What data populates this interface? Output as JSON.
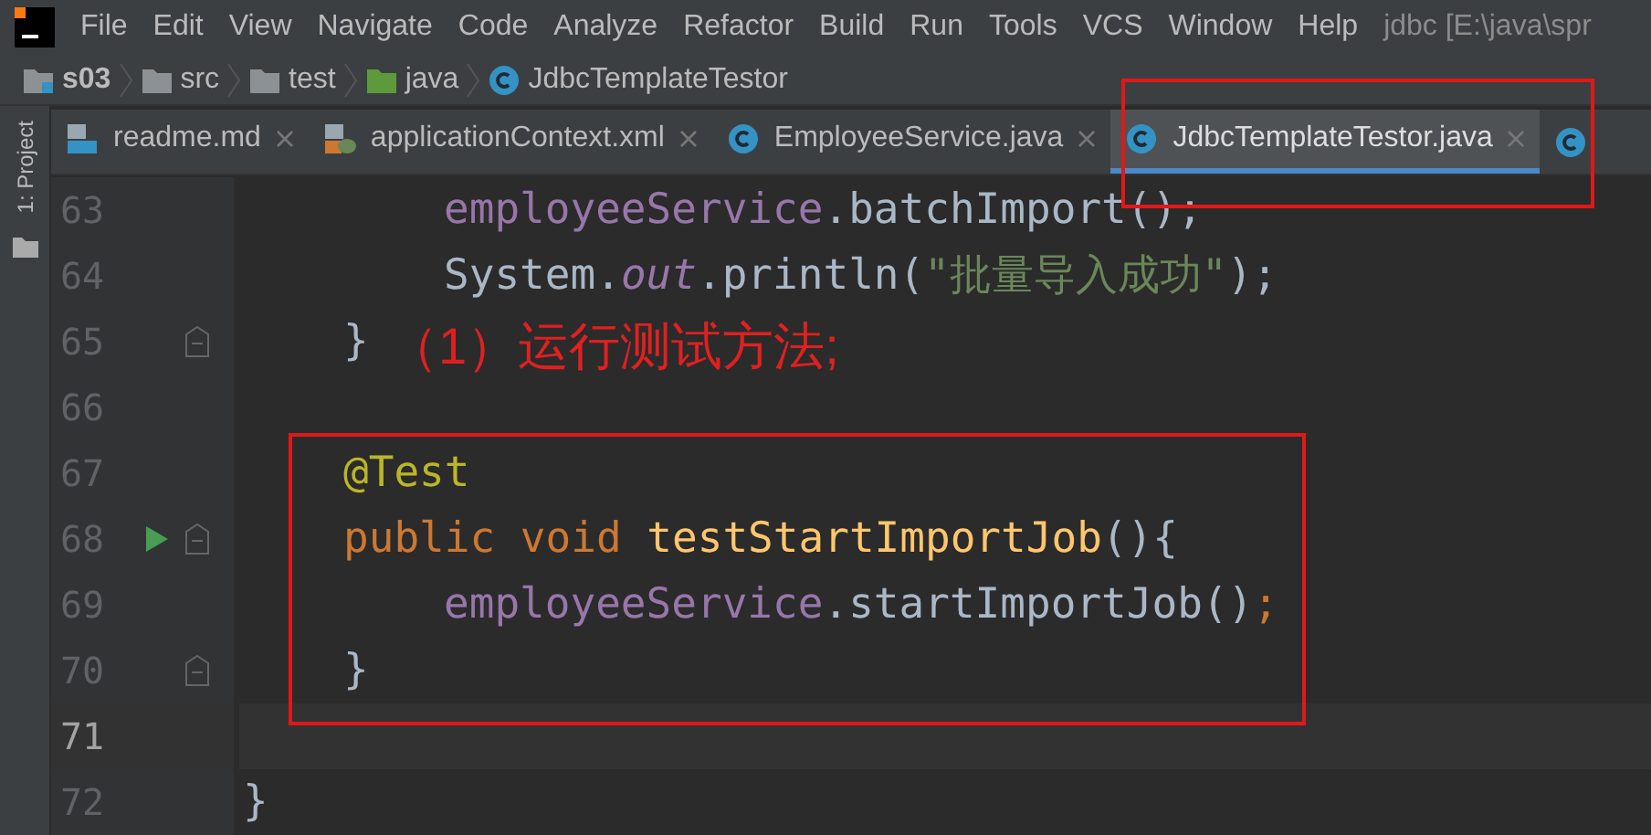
{
  "menu": [
    "File",
    "Edit",
    "View",
    "Navigate",
    "Code",
    "Analyze",
    "Refactor",
    "Build",
    "Run",
    "Tools",
    "VCS",
    "Window",
    "Help"
  ],
  "window": {
    "title": "jdbc [E:\\java\\spr"
  },
  "breadcrumb": [
    {
      "label": "s03",
      "kind": "module"
    },
    {
      "label": "src",
      "kind": "folder"
    },
    {
      "label": "test",
      "kind": "folder"
    },
    {
      "label": "java",
      "kind": "source"
    },
    {
      "label": "JdbcTemplateTestor",
      "kind": "class"
    }
  ],
  "side_tool": {
    "label": "1: Project"
  },
  "tabs": [
    {
      "label": "readme.md",
      "kind": "md",
      "selected": false
    },
    {
      "label": "applicationContext.xml",
      "kind": "xml",
      "selected": false
    },
    {
      "label": "EmployeeService.java",
      "kind": "class",
      "selected": false
    },
    {
      "label": "JdbcTemplateTestor.java",
      "kind": "class",
      "selected": true
    }
  ],
  "lines": [
    {
      "number": "63",
      "kind": "body",
      "tokens": [
        {
          "text": "employeeService",
          "kind": "field"
        },
        {
          "text": ".batchImport();"
        }
      ]
    },
    {
      "number": "64",
      "kind": "body",
      "tokens": [
        {
          "text": "System."
        },
        {
          "text": "out",
          "kind": "static"
        },
        {
          "text": ".println("
        },
        {
          "text": "\"批量导入成功\"",
          "kind": "string"
        },
        {
          "text": ");"
        }
      ]
    },
    {
      "number": "65",
      "kind": "member",
      "fold": true,
      "tokens": [
        {
          "text": "}"
        }
      ]
    },
    {
      "number": "66"
    },
    {
      "number": "67",
      "kind": "member",
      "tokens": [
        {
          "text": "@Test",
          "kind": "annotation"
        }
      ]
    },
    {
      "number": "68",
      "kind": "member",
      "run": true,
      "fold": true,
      "tokens": [
        {
          "text": "public void ",
          "kind": "keyword"
        },
        {
          "text": "testStartImportJob",
          "kind": "method"
        },
        {
          "text": "(){"
        }
      ]
    },
    {
      "number": "69",
      "kind": "body",
      "tokens": [
        {
          "text": "employeeService",
          "kind": "field"
        },
        {
          "text": ".startImportJob()"
        },
        {
          "text": ";",
          "kind": "keyword"
        }
      ]
    },
    {
      "number": "70",
      "kind": "member",
      "fold": true,
      "tokens": [
        {
          "text": "}"
        }
      ]
    },
    {
      "number": "71",
      "current": true
    },
    {
      "number": "72",
      "kind": "top",
      "tokens": [
        {
          "text": "}"
        }
      ]
    }
  ],
  "annotation": {
    "text": "（1）运行测试方法;"
  }
}
